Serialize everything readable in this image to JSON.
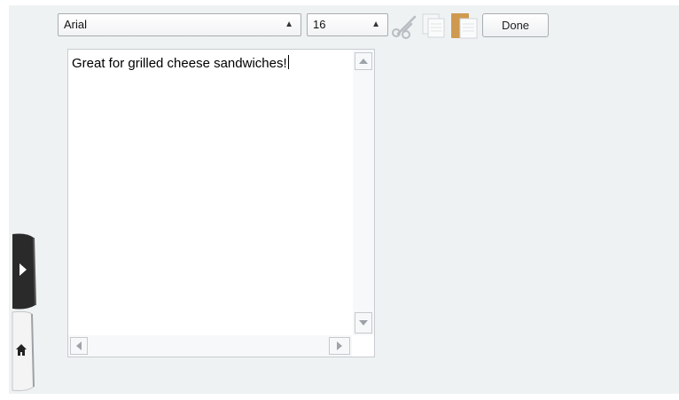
{
  "toolbar": {
    "font_family": "Arial",
    "font_size": "16",
    "done_label": "Done",
    "icons": [
      "scissors-icon",
      "copy-icon",
      "paste-icon"
    ]
  },
  "editor": {
    "text": "Great for grilled cheese sandwiches!"
  },
  "side_tabs": {
    "expand_icon": "play-arrow-icon",
    "home_icon": "home-icon"
  },
  "colors": {
    "page_background": "#eff2f3",
    "expand_tab": "#2a2a2a",
    "home_tab": "#f4f4f4"
  }
}
